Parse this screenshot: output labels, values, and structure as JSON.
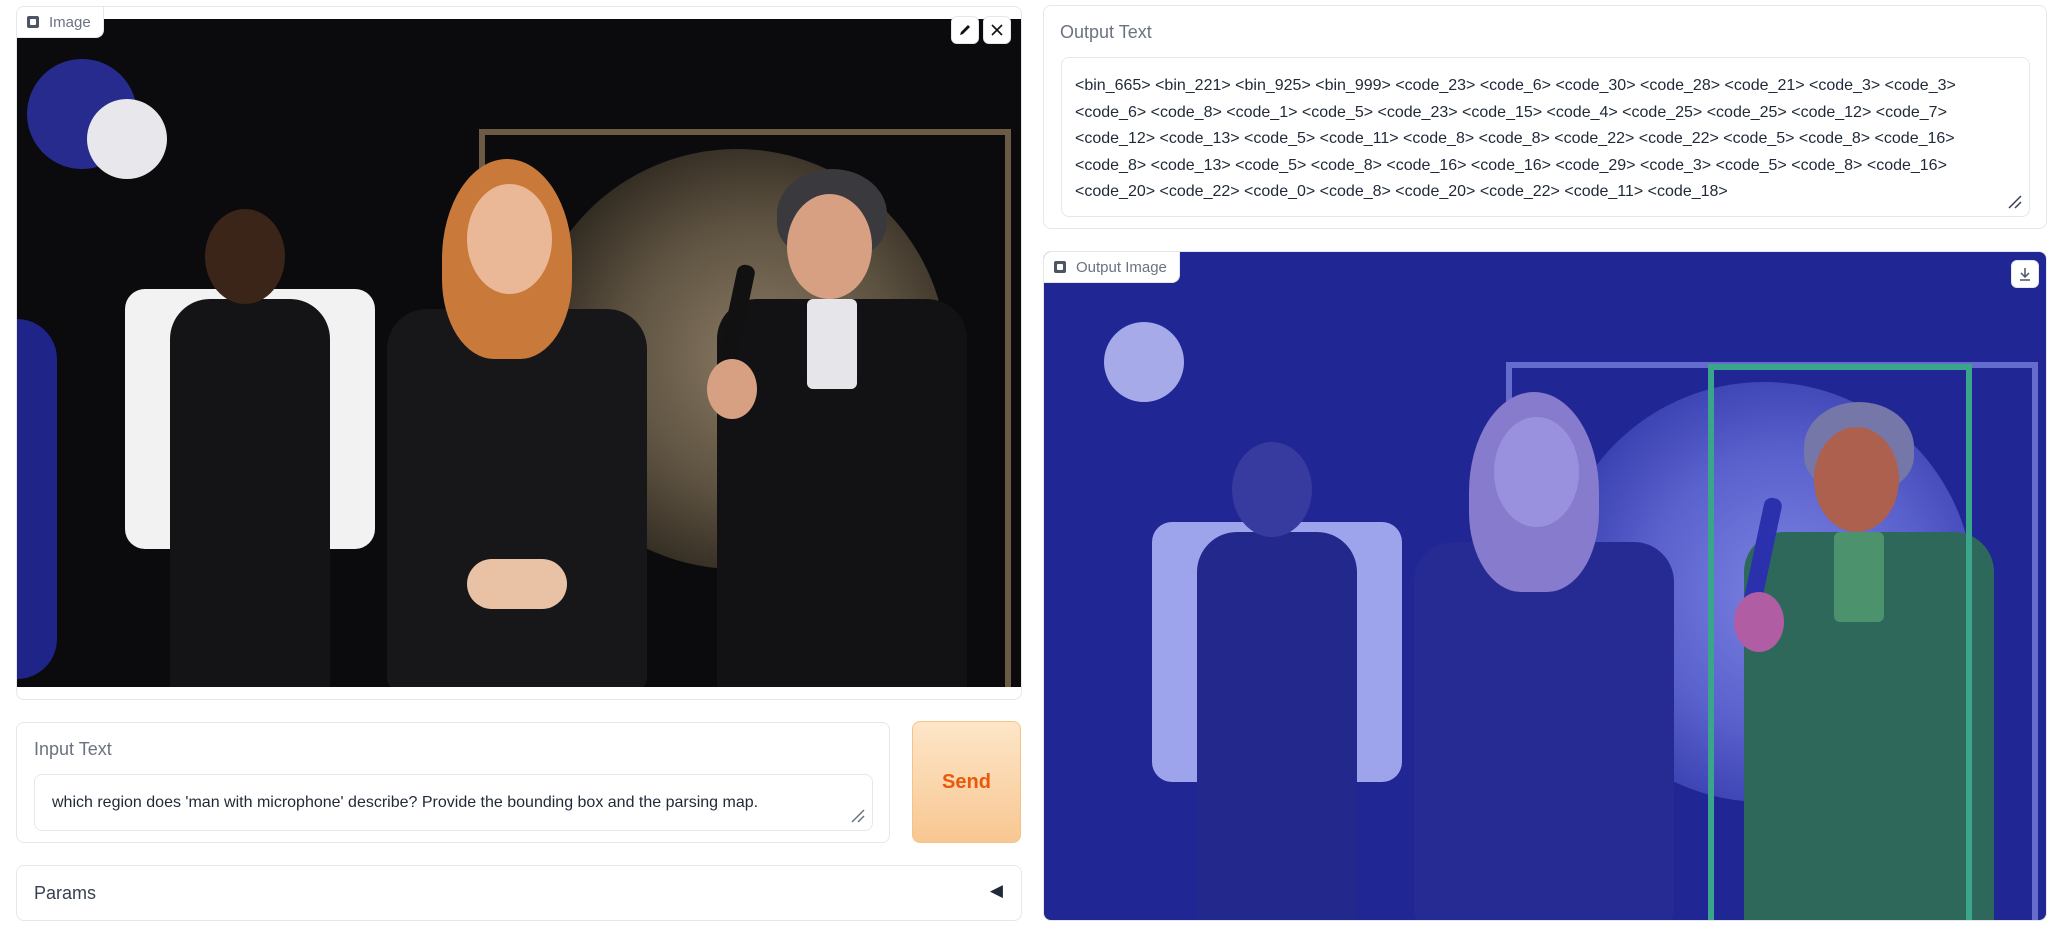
{
  "input_image": {
    "tag_label": "Image",
    "edit_icon": "pencil-icon",
    "close_icon": "close-icon"
  },
  "input_text": {
    "label": "Input Text",
    "value": "which region does 'man with microphone' describe? Provide the bounding box and the parsing map."
  },
  "send_button": {
    "label": "Send"
  },
  "params": {
    "label": "Params",
    "toggle_icon": "◀"
  },
  "output_text": {
    "label": "Output Text",
    "lines": [
      "<bin_665> <bin_221> <bin_925> <bin_999> <code_23> <code_6> <code_30> <code_28> <code_21> <code_3> <code_3>",
      "<code_6> <code_8> <code_1> <code_5> <code_23> <code_15> <code_4> <code_25> <code_25> <code_12> <code_7>",
      "<code_12> <code_13> <code_5> <code_11> <code_8> <code_8> <code_22> <code_22> <code_5> <code_8> <code_16>",
      "<code_8> <code_13> <code_5> <code_8> <code_16> <code_16> <code_29> <code_3> <code_5> <code_8> <code_16>",
      "<code_20> <code_22> <code_0> <code_8> <code_20> <code_22> <code_11> <code_18>"
    ]
  },
  "output_image": {
    "tag_label": "Output Image",
    "download_icon": "download-icon"
  },
  "colors": {
    "send_text": "#ea580c",
    "overlay_blue": "#2f3bd6",
    "bbox_green": "#3aa58a",
    "mask_orange": "#e0701a",
    "mask_green": "#2f7a2c",
    "mask_gray": "#8f8f95",
    "mask_pink": "#e36b8f"
  }
}
